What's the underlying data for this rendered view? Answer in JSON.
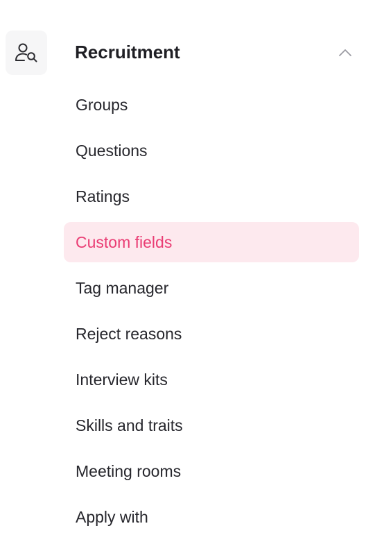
{
  "section": {
    "title": "Recruitment",
    "icon": "users-search-icon",
    "toggle_icon": "chevron-up-icon",
    "expanded": true
  },
  "items": [
    {
      "label": "Groups",
      "active": false
    },
    {
      "label": "Questions",
      "active": false
    },
    {
      "label": "Ratings",
      "active": false
    },
    {
      "label": "Custom fields",
      "active": true
    },
    {
      "label": "Tag manager",
      "active": false
    },
    {
      "label": "Reject reasons",
      "active": false
    },
    {
      "label": "Interview kits",
      "active": false
    },
    {
      "label": "Skills and traits",
      "active": false
    },
    {
      "label": "Meeting rooms",
      "active": false
    },
    {
      "label": "Apply with",
      "active": false
    }
  ],
  "colors": {
    "active_text": "#ea3d74",
    "active_background": "#fde9ee",
    "text": "#26262c",
    "icon_tile": "#f6f6f7"
  }
}
